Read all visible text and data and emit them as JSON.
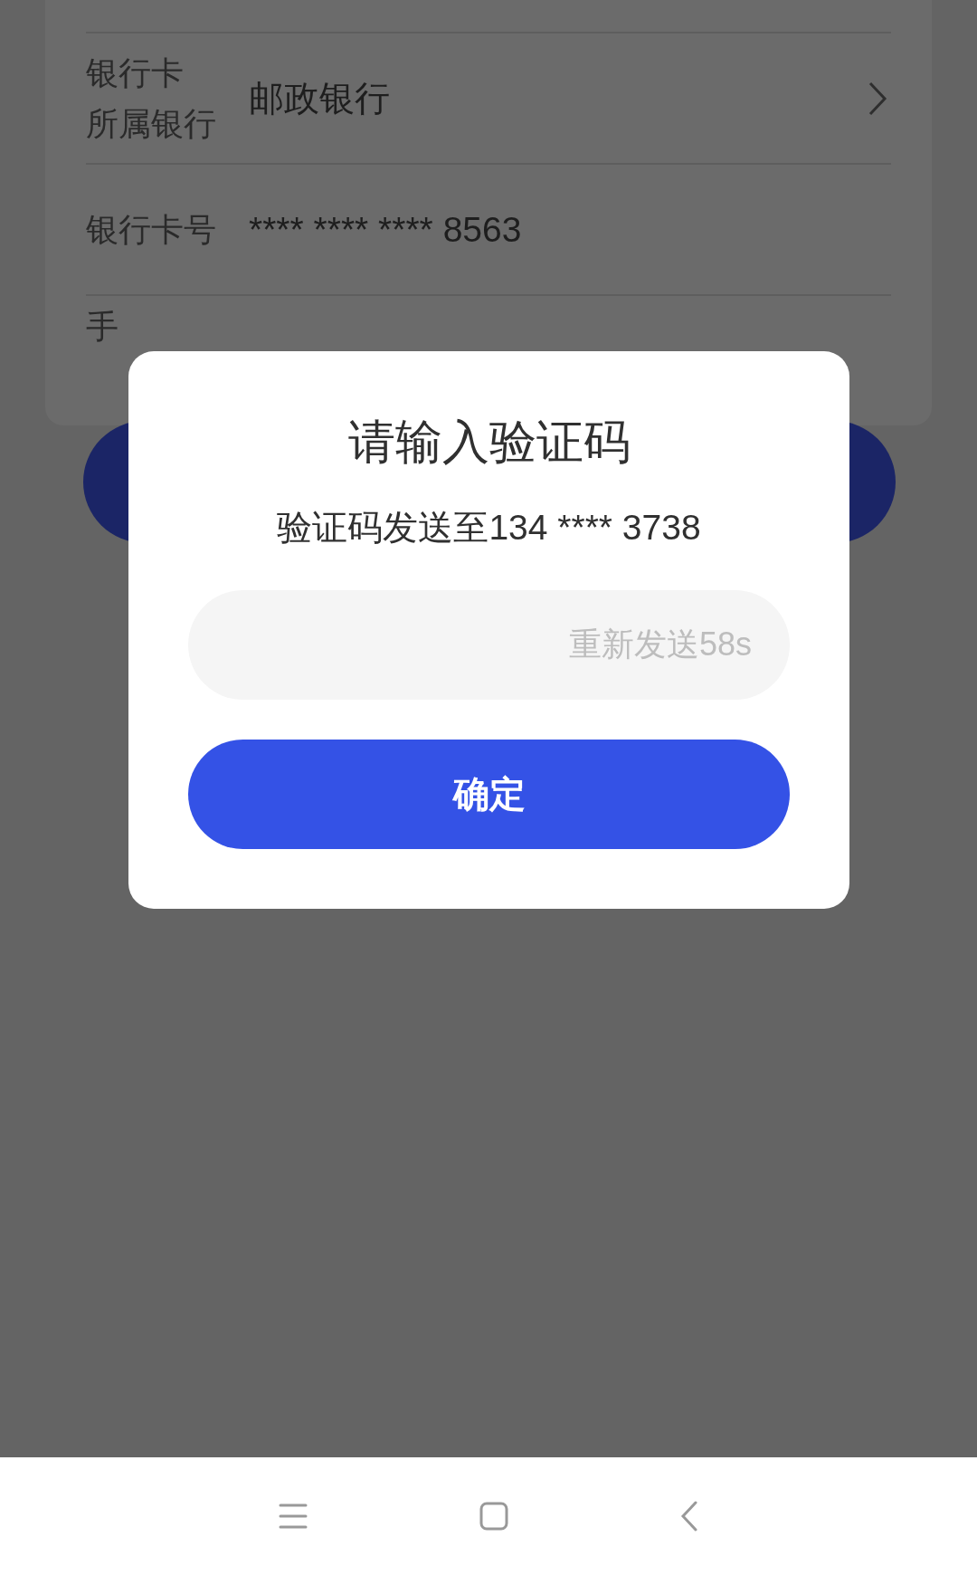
{
  "bank_form": {
    "rows": [
      {
        "kind": "select",
        "label_lines": [
          "银行卡",
          "所属银行"
        ],
        "value": "邮政银行"
      },
      {
        "kind": "text",
        "label_lines": [
          "银行卡号"
        ],
        "value": "**** **** **** 8563"
      },
      {
        "kind": "text",
        "label_lines": [
          "手"
        ]
      }
    ]
  },
  "dialog": {
    "title": "请输入验证码",
    "message": "验证码发送至134 **** 3738",
    "resend": "重新发送58s",
    "confirm": "确定"
  }
}
